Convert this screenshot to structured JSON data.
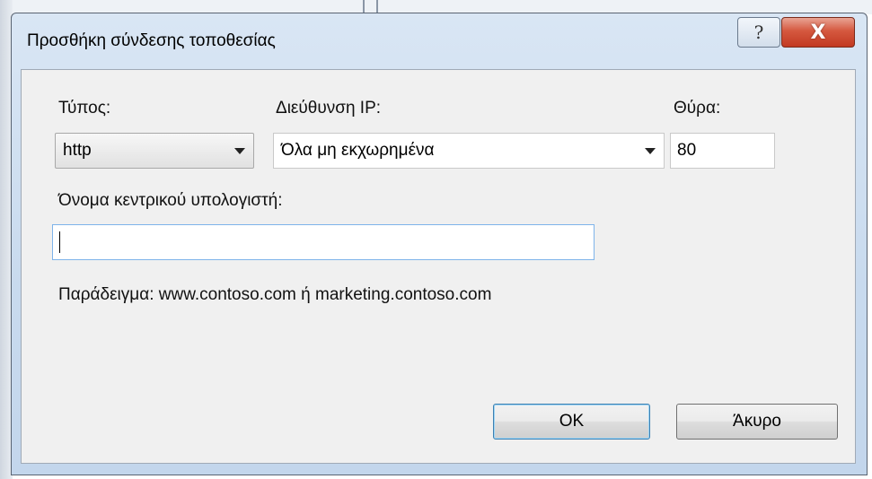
{
  "window": {
    "title": "Προσθήκη σύνδεσης τοποθεσίας",
    "help_glyph": "?",
    "close_glyph": "X"
  },
  "type": {
    "label": "Τύπος:",
    "selected": "http"
  },
  "ip": {
    "label": "Διεύθυνση IP:",
    "selected": "Όλα μη εκχωρημένα"
  },
  "port": {
    "label": "Θύρα:",
    "value": "80"
  },
  "hostname": {
    "label": "Όνομα κεντρικού υπολογιστή:",
    "value": ""
  },
  "example_text": "Παράδειγμα: www.contoso.com ή marketing.contoso.com",
  "buttons": {
    "ok": "OK",
    "cancel": "Άκυρο"
  },
  "icons": [
    "help-icon",
    "close-icon",
    "dropdown-arrow-icon"
  ],
  "colors": {
    "frame": "#c8daee",
    "close_button": "#c23a22",
    "content_bg": "#f0f0f0",
    "focus_border": "#7eb4ea"
  }
}
